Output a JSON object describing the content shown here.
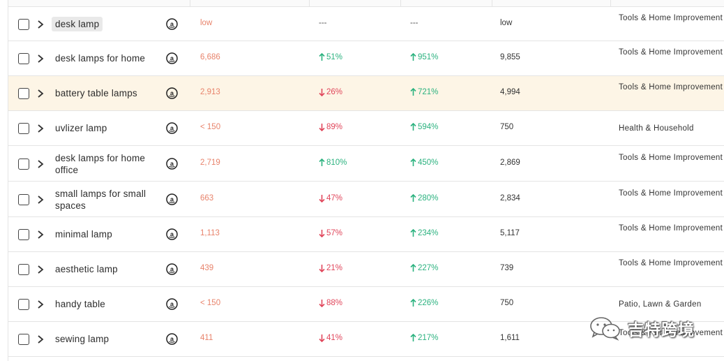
{
  "colors": {
    "volume": "#e8836b",
    "down": "#e0455a",
    "up": "#2bb27f",
    "highlight_row": "#fdf5e6",
    "border": "#e4e4e4"
  },
  "rows": [
    {
      "keyword": "desk lamp",
      "volume": "low",
      "change1": {
        "dir": "none",
        "text": "---"
      },
      "change2": {
        "dir": "none",
        "text": "---"
      },
      "search_volume": "low",
      "category": "Tools & Home Improvement",
      "tag": true,
      "highlight": false
    },
    {
      "keyword": "desk lamps for home",
      "volume": "6,686",
      "change1": {
        "dir": "up",
        "text": "51%"
      },
      "change2": {
        "dir": "up",
        "text": "951%"
      },
      "search_volume": "9,855",
      "category": "Tools & Home Improvement",
      "tag": false,
      "highlight": false
    },
    {
      "keyword": "battery table lamps",
      "volume": "2,913",
      "change1": {
        "dir": "down",
        "text": "26%"
      },
      "change2": {
        "dir": "up",
        "text": "721%"
      },
      "search_volume": "4,994",
      "category": "Tools & Home Improvement",
      "tag": false,
      "highlight": true
    },
    {
      "keyword": "uvlizer lamp",
      "volume": "< 150",
      "change1": {
        "dir": "down",
        "text": "89%"
      },
      "change2": {
        "dir": "up",
        "text": "594%"
      },
      "search_volume": "750",
      "category": "Health & Household",
      "tag": false,
      "highlight": false
    },
    {
      "keyword": "desk lamps for home office",
      "volume": "2,719",
      "change1": {
        "dir": "up",
        "text": "810%"
      },
      "change2": {
        "dir": "up",
        "text": "450%"
      },
      "search_volume": "2,869",
      "category": "Tools & Home Improvement",
      "tag": false,
      "highlight": false
    },
    {
      "keyword": "small lamps for small spaces",
      "volume": "663",
      "change1": {
        "dir": "down",
        "text": "47%"
      },
      "change2": {
        "dir": "up",
        "text": "280%"
      },
      "search_volume": "2,834",
      "category": "Tools & Home Improvement",
      "tag": false,
      "highlight": false
    },
    {
      "keyword": "minimal lamp",
      "volume": "1,113",
      "change1": {
        "dir": "down",
        "text": "57%"
      },
      "change2": {
        "dir": "up",
        "text": "234%"
      },
      "search_volume": "5,117",
      "category": "Tools & Home Improvement",
      "tag": false,
      "highlight": false
    },
    {
      "keyword": "aesthetic lamp",
      "volume": "439",
      "change1": {
        "dir": "down",
        "text": "21%"
      },
      "change2": {
        "dir": "up",
        "text": "227%"
      },
      "search_volume": "739",
      "category": "Tools & Home Improvement",
      "tag": false,
      "highlight": false
    },
    {
      "keyword": "handy table",
      "volume": "< 150",
      "change1": {
        "dir": "down",
        "text": "88%"
      },
      "change2": {
        "dir": "up",
        "text": "226%"
      },
      "search_volume": "750",
      "category": "Patio, Lawn & Garden",
      "tag": false,
      "highlight": false
    },
    {
      "keyword": "sewing lamp",
      "volume": "411",
      "change1": {
        "dir": "down",
        "text": "41%"
      },
      "change2": {
        "dir": "up",
        "text": "217%"
      },
      "search_volume": "1,611",
      "category": "Tools & Home Improvement",
      "tag": false,
      "highlight": false
    }
  ],
  "watermark": {
    "text": "吉特跨境",
    "icon": "wechat-logo-icon"
  },
  "icons": {
    "checkbox": "checkbox-icon",
    "expand": "chevron-right-icon",
    "marketplace": "amazon-icon"
  }
}
